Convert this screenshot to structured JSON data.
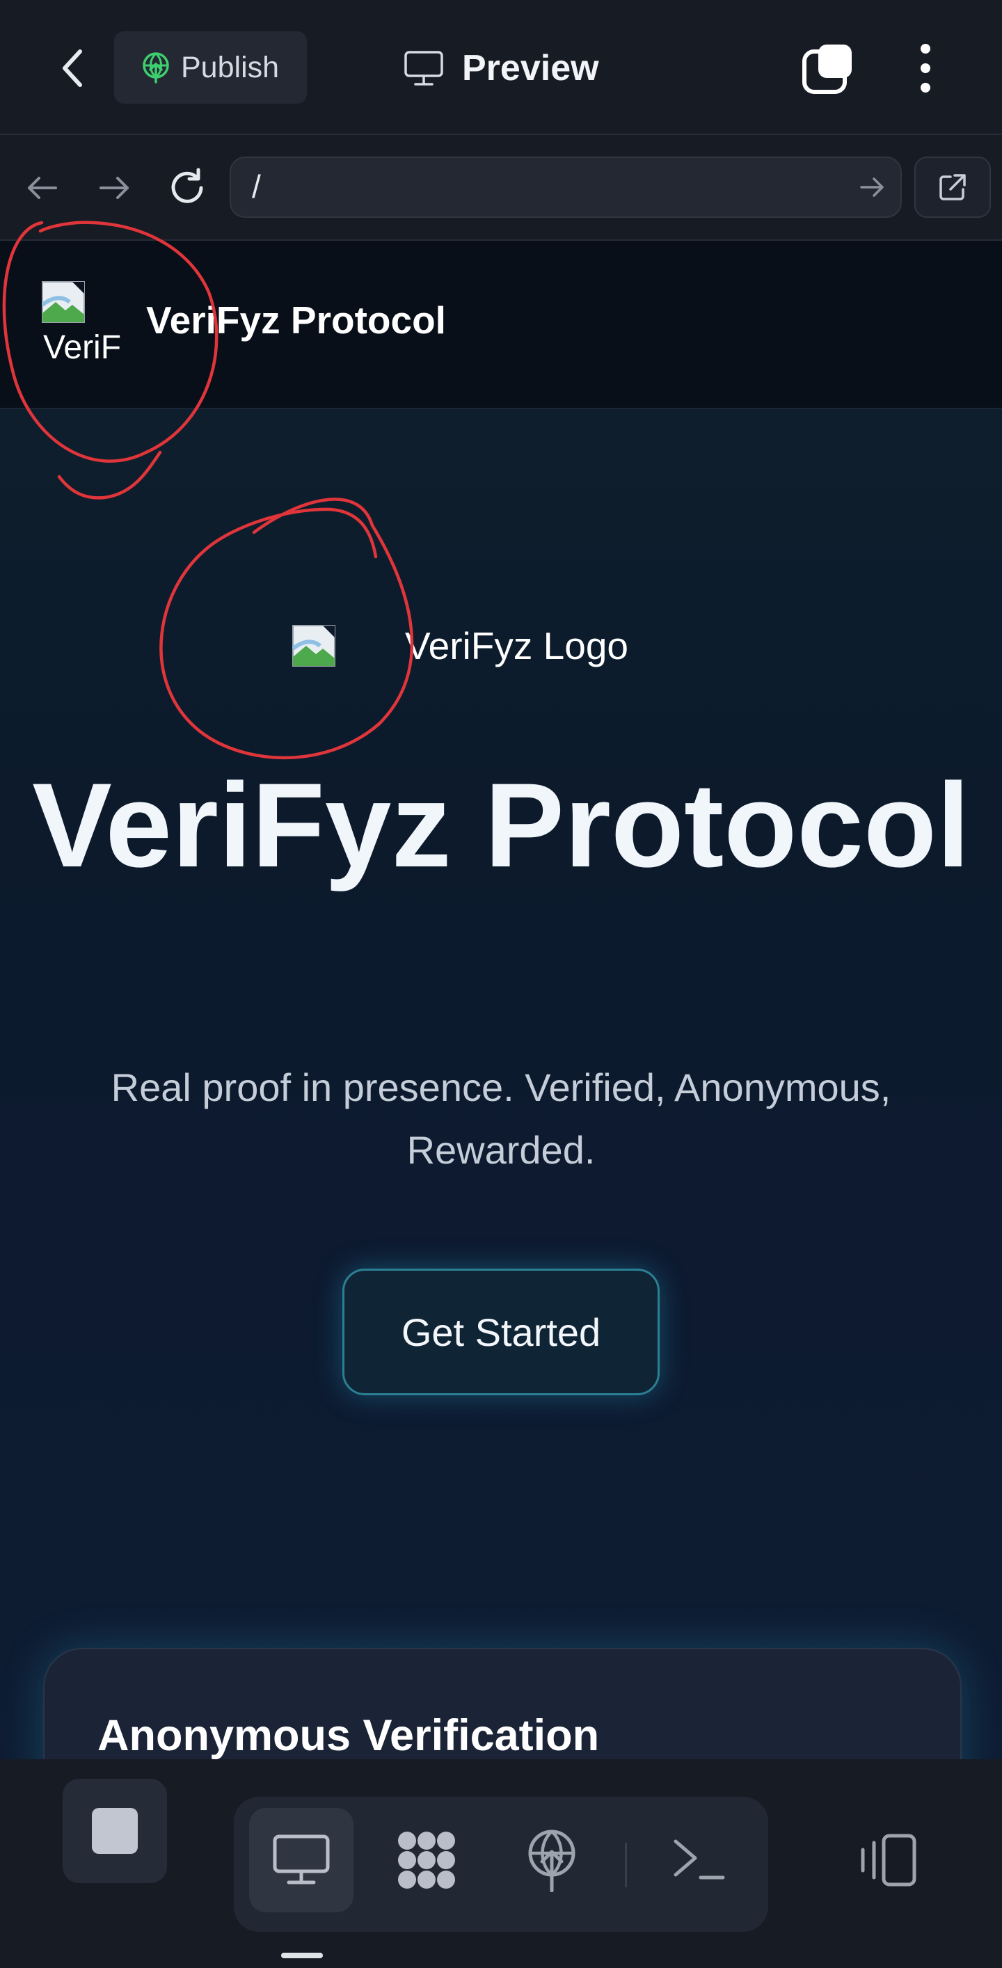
{
  "topbar": {
    "publish_label": "Publish",
    "preview_label": "Preview"
  },
  "browser": {
    "url": "/"
  },
  "site": {
    "header_logo_alt": "VeriF",
    "header_title": "VeriFyz Protocol",
    "hero_logo_alt": "VeriFyz Logo",
    "hero_title": "VeriFyz Protocol",
    "hero_subtitle": "Real proof in presence. Verified, Anonymous, Rewarded.",
    "cta_label": "Get Started",
    "feature_title": "Anonymous Verification"
  },
  "colors": {
    "accent_cyan": "#2b7f93",
    "publish_icon_green": "#3ecf6e",
    "annotation_red": "#e0353a",
    "page_background": "#0d1727"
  },
  "icons": {
    "back": "chevron-left-icon",
    "publish": "globe-upload-icon",
    "preview": "monitor-icon",
    "tabs": "tabs-icon",
    "menu": "vertical-dots-icon",
    "nav_back": "arrow-left-icon",
    "nav_forward": "arrow-right-icon",
    "reload": "refresh-icon",
    "go": "arrow-right-icon",
    "open_external": "external-link-icon",
    "stop": "stop-icon",
    "desktop": "desktop-icon",
    "ai": "ai-agent-icon",
    "deploy": "deploy-globe-icon",
    "shell": "terminal-icon",
    "devices": "device-switch-icon"
  }
}
